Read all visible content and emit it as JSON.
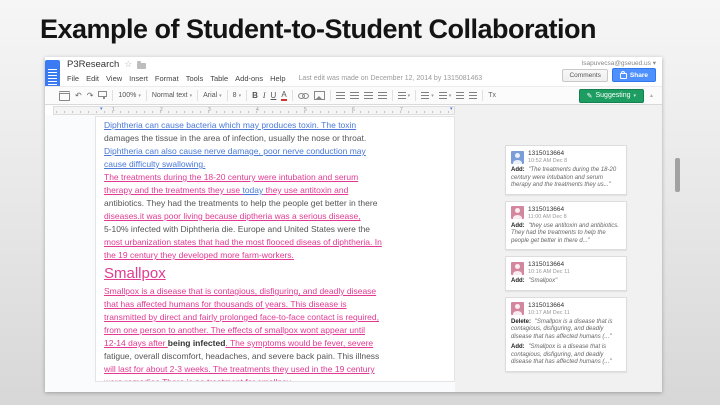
{
  "slide": {
    "title": "Example of Student-to-Student Collaboration"
  },
  "docs": {
    "doc_title": "P3Research",
    "account_email": "lsapuvecsa@gseued.us ▾",
    "menu_items": [
      "File",
      "Edit",
      "View",
      "Insert",
      "Format",
      "Tools",
      "Table",
      "Add-ons",
      "Help"
    ],
    "last_edit_note": "Last edit was made on December 12, 2014 by 1315081463",
    "comments_button_label": "Comments",
    "share_button_label": "Share",
    "toolbar": {
      "zoom_value": "100%",
      "styles_value": "Normal text",
      "font_value": "Arial",
      "font_size_value": "8",
      "bold_label": "B",
      "italic_label": "I",
      "underline_label": "U",
      "text_color_label": "A",
      "clear_format_label": "Tx",
      "suggesting_label": "Suggesting"
    },
    "ruler_numbers": [
      "1",
      "2",
      "3",
      "4",
      "5",
      "6",
      "7"
    ],
    "document_paragraphs": [
      {
        "type": "body",
        "lines": [
          [
            {
              "text": "Diphtheria can cause bacteria which may produces toxin. The toxin",
              "style": "blue"
            }
          ],
          [
            {
              "text": "damages the tissue in the area of infection, usually the nose or throat.",
              "style": "dark"
            }
          ],
          [
            {
              "text": "Diphtheria can also cause nerve damage, poor nerve conduction may",
              "style": "blue"
            }
          ],
          [
            {
              "text": "cause difficulty swallowing.",
              "style": "blue"
            }
          ]
        ]
      },
      {
        "type": "body",
        "lines": [
          [
            {
              "text": "The treatments during the 18-20 century were intubation and serum",
              "style": "pink"
            }
          ],
          [
            {
              "text": "therapy and the treatments they use ",
              "style": "pink"
            },
            {
              "text": "today",
              "style": "blue"
            },
            {
              "text": " they use antitoxin and",
              "style": "pink"
            }
          ],
          [
            {
              "text": "antibiotics. They had the treatments to help the people get better in there",
              "style": "dark"
            }
          ],
          [
            {
              "text": "diseases.it was poor living because diptheria was a serious disease,",
              "style": "pink"
            }
          ],
          [
            {
              "text": "5-10% infected with Diphtheria die. Europe and United States were the",
              "style": "dark"
            }
          ],
          [
            {
              "text": "most urbanization states that had the most flooced diseas of diphtheria. In",
              "style": "pink"
            }
          ],
          [
            {
              "text": "the 19 century they developed more farm-workers.",
              "style": "pink"
            }
          ]
        ]
      },
      {
        "type": "heading",
        "lines": [
          [
            {
              "text": "Smallpox",
              "style": "pink"
            }
          ]
        ]
      },
      {
        "type": "body",
        "lines": [
          [
            {
              "text": "Smallpox is a disease that is contagious, disfiguring, and deadly disease",
              "style": "pink"
            }
          ],
          [
            {
              "text": "that has affected humans for thousands of years. This disease is",
              "style": "pink"
            }
          ],
          [
            {
              "text": "transmitted by direct and fairly prolonged face-to-face contact is required,",
              "style": "pink"
            }
          ],
          [
            {
              "text": "from one person to another. The effects of smallpox wont appear until",
              "style": "pink"
            }
          ],
          [
            {
              "text": "12-14 days after ",
              "style": "pink"
            },
            {
              "text": "being infected",
              "style": "darkbold"
            },
            {
              "text": ". The symptoms would be fever, severe",
              "style": "pink"
            }
          ],
          [
            {
              "text": "fatigue, overall discomfort, headaches, and severe back pain. This illness",
              "style": "dark"
            }
          ],
          [
            {
              "text": "will last for about 2-3 weeks. The treatments they used in the 19 century",
              "style": "pink"
            }
          ],
          [
            {
              "text": "were remedies.There is no treatment for smallpox.",
              "style": "pink"
            }
          ]
        ]
      }
    ],
    "comments": [
      {
        "user": "1315013664",
        "time": "10:52 AM Dec 8",
        "avatar_color": "#7b9ed9",
        "entries": [
          {
            "label": "Add:",
            "text": "\"The treatments during the 18-20 century were intubation and serum therapy and the treatments they us...\""
          }
        ]
      },
      {
        "user": "1315013664",
        "time": "11:00 AM Dec 8",
        "avatar_color": "#d3879e",
        "entries": [
          {
            "label": "Add:",
            "text": "\"they use antitoxin and antibiotics. They had the treatments to help the people get better in there d...\""
          }
        ]
      },
      {
        "user": "1315013664",
        "time": "10:16 AM Dec 11",
        "avatar_color": "#d3879e",
        "entries": [
          {
            "label": "Add:",
            "text": "\"Smallpox\""
          }
        ]
      },
      {
        "user": "1315013664",
        "time": "10:17 AM Dec 11",
        "avatar_color": "#d3879e",
        "entries": [
          {
            "label": "Delete:",
            "text": "\"Smallpox is a disease that is contagious, disfiguring, and deadly disease that has affected humans (...\""
          },
          {
            "label": "Add:",
            "text": "\"Smallpox is a disease that is contagious, disfiguring, and deadly disease that has affected humans (...\""
          }
        ]
      }
    ],
    "colors": {
      "share_button": "#4d90fe",
      "suggesting_button": "#1d9d61",
      "suggestion_blue": "#4a79d8",
      "suggestion_pink": "#e23a92",
      "docs_logo_blue": "#3a7af2"
    }
  }
}
